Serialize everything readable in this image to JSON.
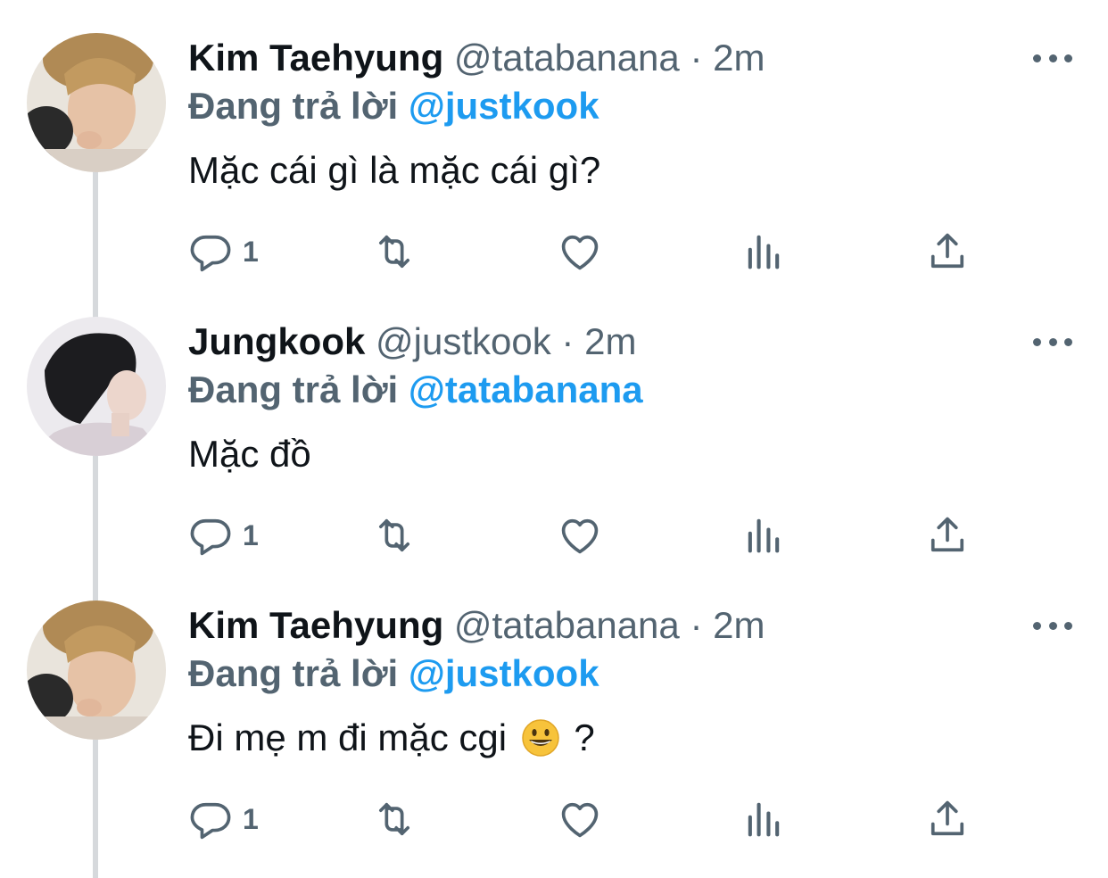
{
  "thread": {
    "tweets": [
      {
        "display_name": "Kim Taehyung",
        "handle": "@tatabanana",
        "separator": "·",
        "time": "2m",
        "replying_label": "Đang trả lời",
        "replying_to": "@justkook",
        "text": "Mặc cái gì là mặc cái gì?",
        "text_suffix": "",
        "reply_count": "1",
        "avatar": "avatar-taehyung"
      },
      {
        "display_name": "Jungkook",
        "handle": "@justkook",
        "separator": "·",
        "time": "2m",
        "replying_label": "Đang trả lời",
        "replying_to": "@tatabanana",
        "text": "Mặc đồ",
        "text_suffix": "",
        "reply_count": "1",
        "avatar": "avatar-jungkook"
      },
      {
        "display_name": "Kim Taehyung",
        "handle": "@tatabanana",
        "separator": "·",
        "time": "2m",
        "replying_label": "Đang trả lời",
        "replying_to": "@justkook",
        "text": "Đi mẹ m đi mặc cgi",
        "text_suffix": "?",
        "reply_count": "1",
        "avatar": "avatar-taehyung"
      }
    ]
  },
  "icons": {
    "reply": "reply-icon",
    "retweet": "retweet-icon",
    "like": "heart-icon",
    "views": "analytics-icon",
    "share": "share-icon",
    "more": "more-icon",
    "emoji": "grinning-face-emoji"
  },
  "colors": {
    "text": "#0f1419",
    "secondary": "#536471",
    "accent": "#1d9bf0",
    "thread_line": "#d6d9dc"
  }
}
